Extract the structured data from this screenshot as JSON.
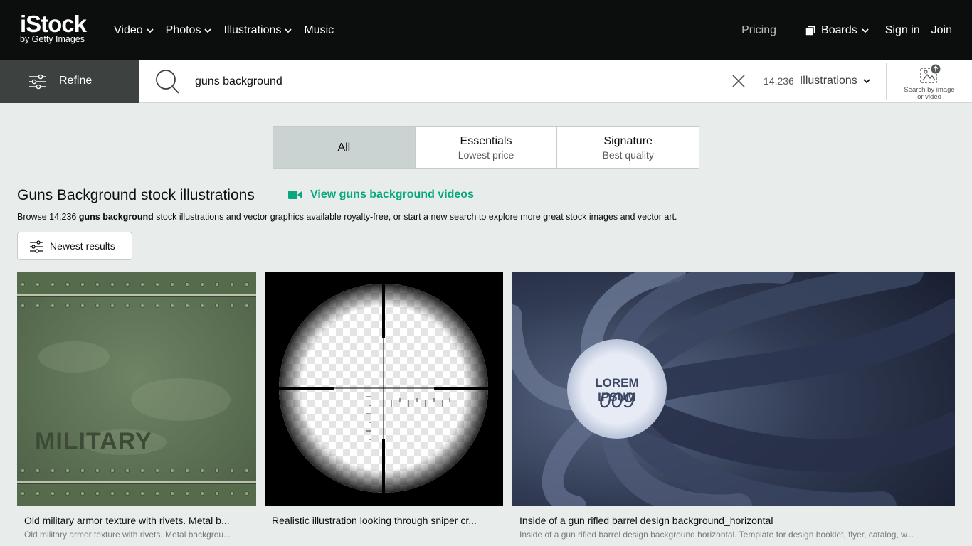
{
  "brand": {
    "name": "iStock",
    "tagline": "by Getty Images"
  },
  "nav": {
    "items": [
      {
        "label": "Video"
      },
      {
        "label": "Photos"
      },
      {
        "label": "Illustrations"
      },
      {
        "label": "Music"
      }
    ],
    "pricing": "Pricing",
    "boards": "Boards",
    "sign_in": "Sign in",
    "join": "Join"
  },
  "search": {
    "refine_label": "Refine",
    "query": "guns background",
    "result_count": "14,236",
    "media_type": "Illustrations",
    "search_by_image_line1": "Search by image",
    "search_by_image_line2": "or video"
  },
  "segments": [
    {
      "title": "All",
      "subtitle": ""
    },
    {
      "title": "Essentials",
      "subtitle": "Lowest price"
    },
    {
      "title": "Signature",
      "subtitle": "Best quality"
    }
  ],
  "page": {
    "heading": "Guns Background stock illustrations",
    "video_link": "View guns background videos",
    "browse_prefix": "Browse 14,236 ",
    "browse_bold": "guns background",
    "browse_suffix": " stock illustrations and vector graphics available royalty-free, or start a new search to explore more great stock images and vector art.",
    "sort_label": "Newest results"
  },
  "results": [
    {
      "title": "Old military armor texture with rivets. Metal b...",
      "description": "Old military armor texture with rivets. Metal backgrou...",
      "image_text": "MILITARY"
    },
    {
      "title": "Realistic illustration looking through sniper cr...",
      "description": ""
    },
    {
      "title": "Inside of a gun rifled barrel design background_horizontal",
      "description": "Inside of a gun rifled barrel design background horizontal. Template for design booklet, flyer, catalog, w...",
      "image_text_line1": "LOREM IPSUM",
      "image_text_line2": "009"
    }
  ],
  "colors": {
    "nav_bg": "#0c0d0d",
    "refine_bg": "#3d4240",
    "accent_green": "#08a77e",
    "page_bg": "#e8edec"
  }
}
